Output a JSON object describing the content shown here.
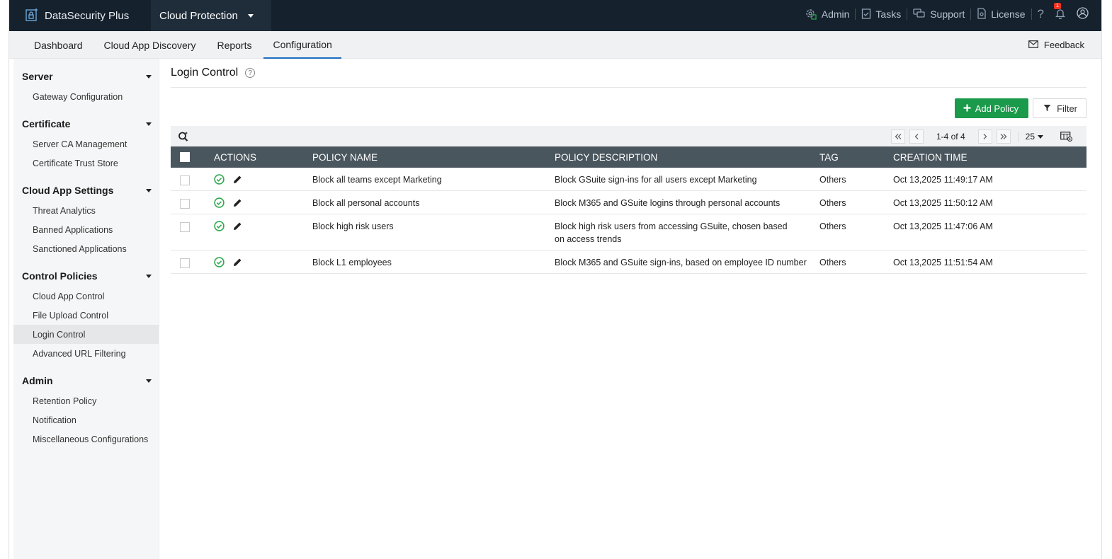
{
  "app": {
    "brand": "DataSecurity Plus",
    "product": "Cloud Protection"
  },
  "top_links": {
    "admin": "Admin",
    "tasks": "Tasks",
    "support": "Support",
    "license": "License",
    "help": "?",
    "notification_count": "1"
  },
  "nav": {
    "tabs": [
      {
        "label": "Dashboard"
      },
      {
        "label": "Cloud App Discovery"
      },
      {
        "label": "Reports"
      },
      {
        "label": "Configuration"
      }
    ],
    "feedback": "Feedback"
  },
  "sidebar": {
    "groups": [
      {
        "title": "Server",
        "items": [
          {
            "label": "Gateway Configuration"
          }
        ]
      },
      {
        "title": "Certificate",
        "items": [
          {
            "label": "Server CA Management"
          },
          {
            "label": "Certificate Trust Store"
          }
        ]
      },
      {
        "title": "Cloud App Settings",
        "items": [
          {
            "label": "Threat Analytics"
          },
          {
            "label": "Banned Applications"
          },
          {
            "label": "Sanctioned Applications"
          }
        ]
      },
      {
        "title": "Control Policies",
        "items": [
          {
            "label": "Cloud App Control"
          },
          {
            "label": "File Upload Control"
          },
          {
            "label": "Login Control"
          },
          {
            "label": "Advanced URL Filtering"
          }
        ]
      },
      {
        "title": "Admin",
        "items": [
          {
            "label": "Retention Policy"
          },
          {
            "label": "Notification"
          },
          {
            "label": "Miscellaneous Configurations"
          }
        ]
      }
    ]
  },
  "page": {
    "title": "Login Control",
    "add_policy": "Add Policy",
    "filter": "Filter"
  },
  "pager": {
    "range": "1-4 of 4",
    "page_size": "25"
  },
  "table": {
    "headers": {
      "actions": "ACTIONS",
      "name": "POLICY NAME",
      "description": "POLICY DESCRIPTION",
      "tag": "TAG",
      "created": "CREATION TIME"
    },
    "rows": [
      {
        "name": "Block all teams except Marketing",
        "description": "Block GSuite sign-ins for all users except Marketing",
        "tag": "Others",
        "created": "Oct 13,2025 11:49:17 AM"
      },
      {
        "name": "Block all personal accounts",
        "description": "Block M365 and GSuite logins through personal accounts",
        "tag": "Others",
        "created": "Oct 13,2025 11:50:12 AM"
      },
      {
        "name": "Block high risk users",
        "description": "Block high risk users from accessing GSuite, chosen based on access trends",
        "tag": "Others",
        "created": "Oct 13,2025 11:47:06 AM"
      },
      {
        "name": "Block L1 employees",
        "description": "Block M365 and GSuite sign-ins, based on employee ID number",
        "tag": "Others",
        "created": "Oct 13,2025 11:51:54 AM"
      }
    ]
  },
  "colors": {
    "topbar": "#15212d",
    "accent_green": "#1a9a4a",
    "table_header": "#4a565e",
    "active_tab_underline": "#1c6ec0",
    "status_green": "#2fa84f"
  }
}
